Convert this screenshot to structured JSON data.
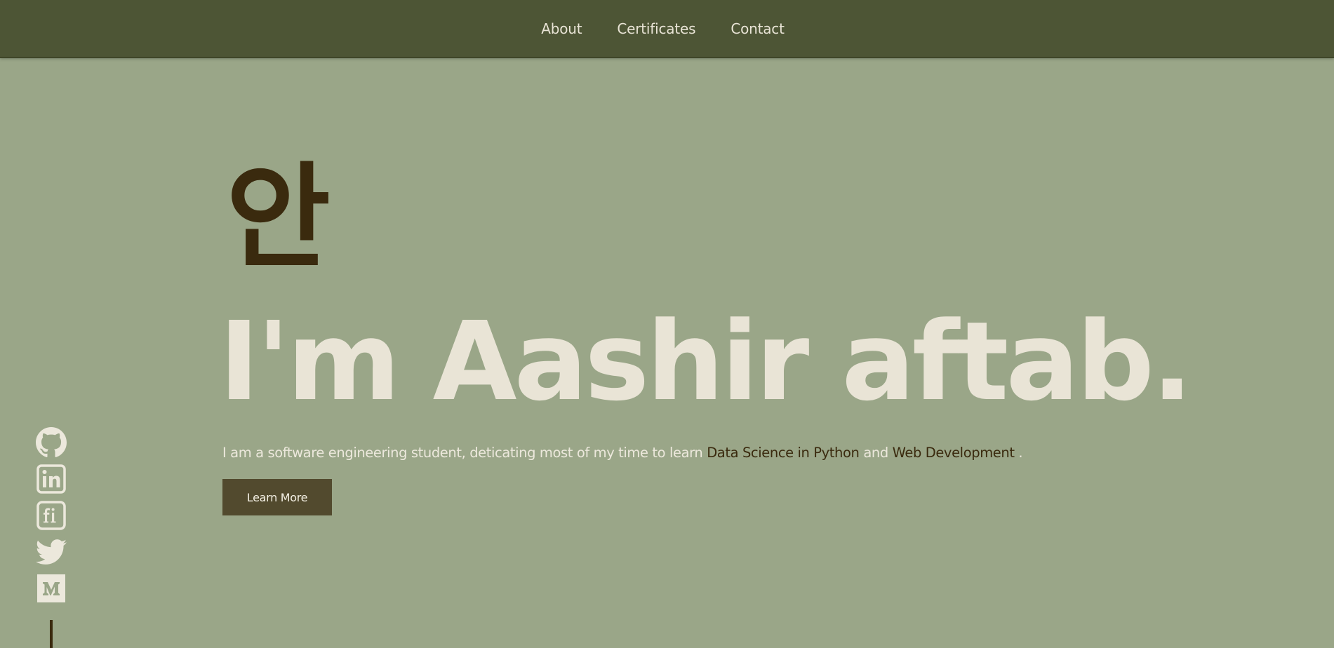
{
  "nav": {
    "links": [
      "About",
      "Certificates",
      "Contact"
    ]
  },
  "hero": {
    "glyph": "안",
    "headline": "I'm Aashir aftab.",
    "intro": {
      "prefix": "I am a software engineering student, deticating most of my time to learn ",
      "highlight1": "Data Science in Python",
      "middle": " and ",
      "highlight2": "Web Development",
      "suffix": " ."
    },
    "button_label": "Learn More"
  },
  "social": {
    "icons": [
      "github-icon",
      "linkedin-icon",
      "freecodecamp-icon",
      "twitter-icon",
      "medium-icon"
    ]
  },
  "colors": {
    "background": "#9aa688",
    "navbar": "#4d5535",
    "light_text": "#e9e4d6",
    "dark_accent": "#3a2a0e",
    "button": "#524a2e"
  }
}
